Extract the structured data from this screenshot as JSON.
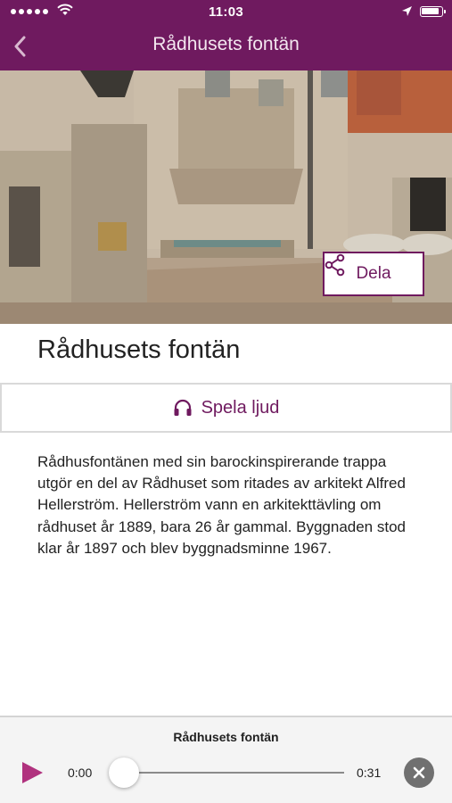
{
  "status_bar": {
    "time": "11:03"
  },
  "nav": {
    "title": "Rådhusets fontän",
    "back_icon": "chevron-left-icon"
  },
  "hero": {
    "share_label": "Dela",
    "share_icon": "share-icon"
  },
  "content": {
    "title": "Rådhusets fontän",
    "play_audio_label": "Spela ljud",
    "play_audio_icon": "headphones-icon",
    "description": "Rådhusfontänen med sin barockinspirerande trappa utgör en del av Rådhuset som ritades av arkitekt Alfred Hellerström. Hellerström vann en arkitekttävling om rådhuset år 1889, bara 26 år gammal. Byggnaden stod klar år 1897 och blev byggnadsminne 1967."
  },
  "player": {
    "title": "Rådhusets fontän",
    "current_time": "0:00",
    "total_time": "0:31",
    "progress": 0
  },
  "colors": {
    "brand": "#6f1a5f",
    "play_accent": "#b0327e"
  }
}
